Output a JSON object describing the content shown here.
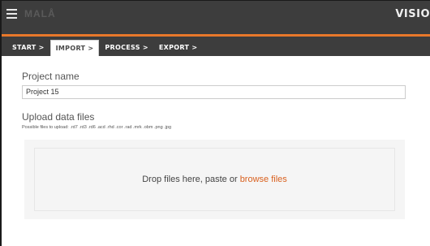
{
  "header": {
    "logo_text": "MALÅ",
    "brand": "VISIO",
    "menu_icon": "hamburger-icon",
    "accent_color": "#e8782a"
  },
  "steps": [
    {
      "label": "START >",
      "active": false
    },
    {
      "label": "IMPORT >",
      "active": true
    },
    {
      "label": "PROCESS >",
      "active": false
    },
    {
      "label": "EXPORT >",
      "active": false
    }
  ],
  "form": {
    "project_name_label": "Project name",
    "project_name_value": "Project 15",
    "upload_label": "Upload data files",
    "upload_hint": "Possible files to upload: .rd7 .rd3 .rd6 .acd .rhd .cor .rad .mrk .obm .png .jpg"
  },
  "dropzone": {
    "text_before": "Drop files here, paste or ",
    "link_text": "browse files"
  }
}
